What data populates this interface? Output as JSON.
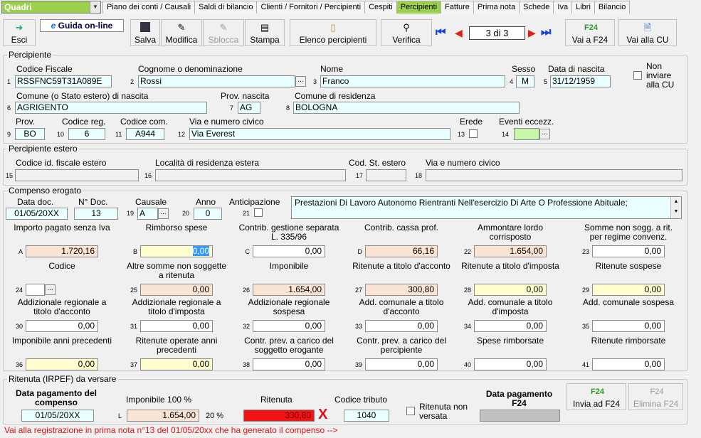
{
  "nav": {
    "combo": "Quadri",
    "tabs": [
      "Piano dei conti / Causali",
      "Saldi di bilancio",
      "Clienti / Fornitori / Percipienti",
      "Cespiti",
      "Percipienti",
      "Fatture",
      "Prima nota",
      "Schede",
      "Iva",
      "Libri",
      "Bilancio"
    ]
  },
  "toolbar": {
    "exit": "Esci",
    "help": "Guida on-line",
    "save": "Salva",
    "edit": "Modifica",
    "unlock": "Sblocca",
    "print": "Stampa",
    "list": "Elenco percipienti",
    "verify": "Verifica",
    "page": "3 di 3",
    "f24": "Vai a F24",
    "cu": "Vai alla CU"
  },
  "percipiente": {
    "title": "Percipiente",
    "labels": {
      "cf": "Codice Fiscale",
      "cognome": "Cognome o denominazione",
      "nome": "Nome",
      "sesso": "Sesso",
      "nascita": "Data di nascita",
      "noncu": "Non inviare alla CU",
      "comune_n": "Comune (o Stato estero) di nascita",
      "prov_n": "Prov. nascita",
      "comune_r": "Comune di residenza",
      "prov": "Prov.",
      "cod_reg": "Codice reg.",
      "cod_com": "Codice com.",
      "via": "Via e numero civico",
      "erede": "Erede",
      "eventi": "Eventi eccezz."
    },
    "values": {
      "cf": "RSSFNC59T31A089E",
      "cognome": "Rossi",
      "nome": "Franco",
      "sesso": "M",
      "nascita": "31/12/1959",
      "comune_n": "AGRIGENTO",
      "prov_n": "AG",
      "comune_r": "BOLOGNA",
      "prov": "BO",
      "cod_reg": "6",
      "cod_com": "A944",
      "via": "Via Everest"
    }
  },
  "estero": {
    "title": "Percipiente estero",
    "labels": {
      "cod_id": "Codice id. fiscale estero",
      "loc": "Località di residenza estera",
      "stato": "Cod. St. estero",
      "via": "Via e numero civico"
    }
  },
  "compenso": {
    "title": "Compenso erogato",
    "labels": {
      "data": "Data doc.",
      "ndoc": "N° Doc.",
      "causale": "Causale",
      "anno": "Anno",
      "antic": "Anticipazione"
    },
    "values": {
      "data": "01/05/20XX",
      "ndoc": "13",
      "causale": "A",
      "anno": "0",
      "descr": "Prestazioni Di Lavoro Autonomo Rientranti Nell'esercizio Di Arte O Professione Abituale;"
    },
    "r1": [
      {
        "n": "A",
        "l": "Importo pagato senza Iva",
        "v": "1.720,16"
      },
      {
        "n": "B",
        "l": "Rimborso spese",
        "v": "0,00"
      },
      {
        "n": "C",
        "l": "Contrib. gestione separata L. 335/96",
        "v": "0,00"
      },
      {
        "n": "D",
        "l": "Contrib. cassa prof.",
        "v": "66,16"
      },
      {
        "n": "22",
        "l": "Ammontare lordo corrisposto",
        "v": "1.654,00"
      },
      {
        "n": "23",
        "l": "Somme non sogg. a rit. per regime convenz.",
        "v": "0,00"
      }
    ],
    "r2": [
      {
        "n": "24",
        "l": "Codice",
        "v": ""
      },
      {
        "n": "25",
        "l": "Altre somme non soggette a ritenuta",
        "v": "0,00"
      },
      {
        "n": "26",
        "l": "Imponibile",
        "v": "1.654,00"
      },
      {
        "n": "27",
        "l": "Ritenute a titolo d'acconto",
        "v": "300,80"
      },
      {
        "n": "28",
        "l": "Ritenute a titolo d'imposta",
        "v": "0,00"
      },
      {
        "n": "29",
        "l": "Ritenute sospese",
        "v": "0,00"
      }
    ],
    "r3": [
      {
        "n": "30",
        "l": "Addizionale regionale a titolo d'acconto",
        "v": "0,00"
      },
      {
        "n": "31",
        "l": "Addizionale regionale a titolo d'imposta",
        "v": "0,00"
      },
      {
        "n": "32",
        "l": "Addizionale regionale sospesa",
        "v": "0,00"
      },
      {
        "n": "33",
        "l": "Add. comunale a titolo d'acconto",
        "v": "0,00"
      },
      {
        "n": "34",
        "l": "Add. comunale a titolo d'imposta",
        "v": "0,00"
      },
      {
        "n": "35",
        "l": "Add. comunale sospesa",
        "v": "0,00"
      }
    ],
    "r4": [
      {
        "n": "36",
        "l": "Imponibile anni precedenti",
        "v": "0,00"
      },
      {
        "n": "37",
        "l": "Ritenute operate anni precedenti",
        "v": "0,00"
      },
      {
        "n": "38",
        "l": "Contr. prev. a carico del soggetto erogante",
        "v": "0,00"
      },
      {
        "n": "39",
        "l": "Contr. prev. a carico del percipiente",
        "v": "0,00"
      },
      {
        "n": "40",
        "l": "Spese rimborsate",
        "v": "0,00"
      },
      {
        "n": "41",
        "l": "Ritenute rimborsate",
        "v": "0,00"
      }
    ]
  },
  "ritenuta": {
    "title": "Ritenuta (IRPEF) da versare",
    "labels": {
      "data": "Data pagamento del compenso",
      "imp": "Imponibile 100 %",
      "rit": "Ritenuta",
      "trib": "Codice tributo",
      "nonv": "Ritenuta non versata",
      "f24": "Data pagamento F24",
      "invia": "Invia ad F24",
      "elimina": "Elimina F24",
      "pct": "20 %",
      "x": "X",
      "l": "L"
    },
    "values": {
      "data": "01/05/20XX",
      "imp": "1.654,00",
      "rit": "330,80",
      "trib": "1040"
    }
  },
  "footer": "Vai alla registrazione in prima nota n°13 del 01/05/20xx che ha generato il compenso -->"
}
